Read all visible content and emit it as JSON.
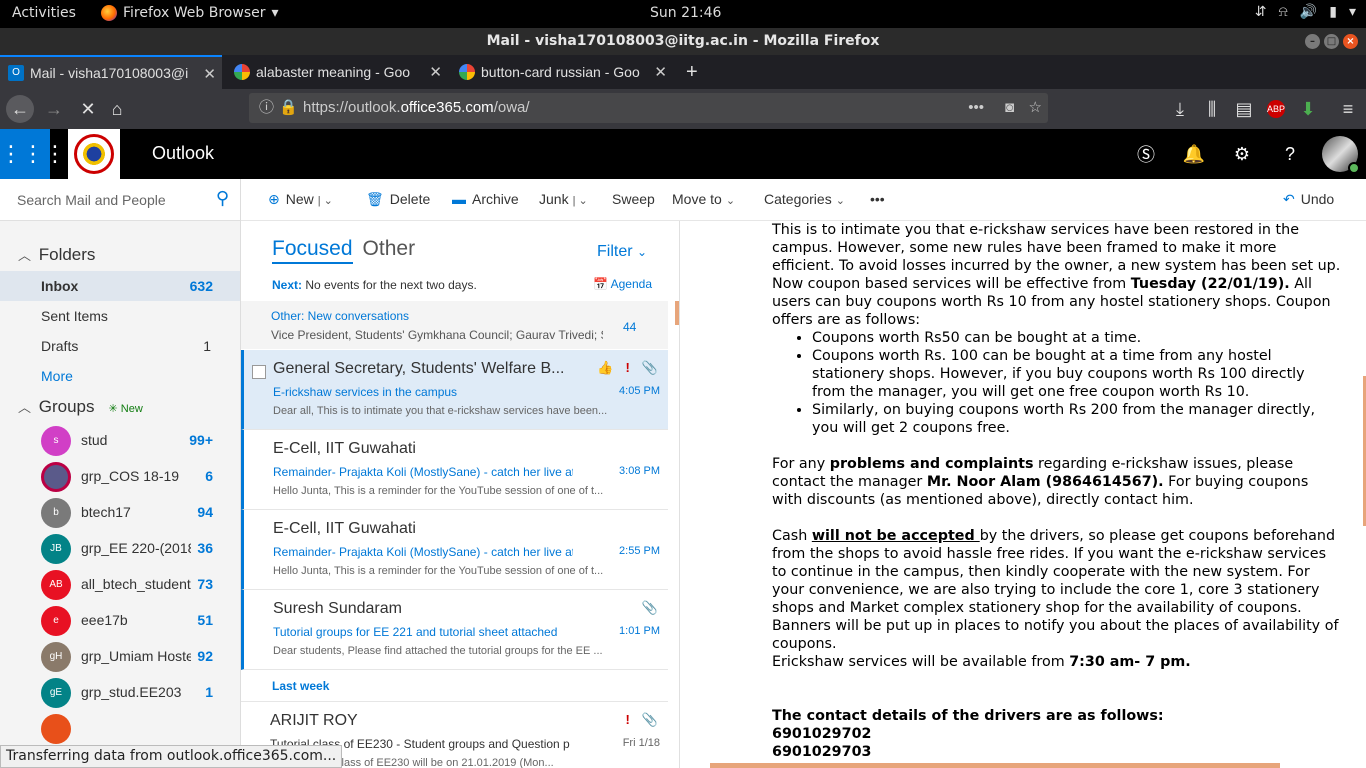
{
  "system": {
    "activities": "Activities",
    "app": "Firefox Web Browser",
    "clock": "Sun 21:46"
  },
  "window": {
    "title": "Mail - visha170108003@iitg.ac.in - Mozilla Firefox"
  },
  "tabs": [
    {
      "label": "Mail - visha170108003@i"
    },
    {
      "label": "alabaster meaning - Goo"
    },
    {
      "label": "button-card russian - Goo"
    }
  ],
  "url": {
    "prefix": "https://outlook.",
    "domain": "office365.com",
    "path": "/owa/"
  },
  "owa": {
    "brand": "Outlook"
  },
  "search": {
    "placeholder": "Search Mail and People"
  },
  "folders": {
    "heading": "Folders",
    "items": [
      {
        "label": "Inbox",
        "count": "632"
      },
      {
        "label": "Sent Items",
        "count": ""
      },
      {
        "label": "Drafts",
        "count": "1"
      }
    ],
    "more": "More"
  },
  "groups": {
    "heading": "Groups",
    "new_label": "New",
    "items": [
      {
        "initials": "s",
        "label": "stud",
        "count": "99+",
        "color": "#d13fc6"
      },
      {
        "initials": "",
        "label": "grp_COS 18-19",
        "count": "6",
        "color": "#5a5a8a"
      },
      {
        "initials": "b",
        "label": "btech17",
        "count": "94",
        "color": "#7a7a7a"
      },
      {
        "initials": "JB",
        "label": "grp_EE 220-(2018",
        "count": "36",
        "color": "#038387"
      },
      {
        "initials": "AB",
        "label": "all_btech_students",
        "count": "73",
        "color": "#e81123"
      },
      {
        "initials": "e",
        "label": "eee17b",
        "count": "51",
        "color": "#e81123"
      },
      {
        "initials": "gH",
        "label": "grp_Umiam Hoste",
        "count": "92",
        "color": "#8a7a6a"
      },
      {
        "initials": "gE",
        "label": "grp_stud.EE203",
        "count": "1",
        "color": "#038387"
      }
    ]
  },
  "toolbar": {
    "new": "New",
    "delete": "Delete",
    "archive": "Archive",
    "junk": "Junk",
    "sweep": "Sweep",
    "move": "Move to",
    "categories": "Categories",
    "more": "•••",
    "undo": "Undo"
  },
  "list": {
    "focused": "Focused",
    "other": "Other",
    "filter": "Filter",
    "next_label": "Next:",
    "next_text": "No events for the next two days.",
    "agenda": "Agenda",
    "other_conv": {
      "title": "Other: New conversations",
      "senders": "Vice President, Students' Gymkhana Council; Gaurav Trivedi; S...",
      "count": "44"
    },
    "messages": [
      {
        "from": "General Secretary, Students' Welfare B...",
        "subject": "E-rickshaw services in the campus",
        "preview": "Dear all, This is to intimate you that e-rickshaw services have been...",
        "time": "4:05 PM"
      },
      {
        "from": "E-Cell, IIT Guwahati",
        "subject": "Remainder- Prajakta Koli (MostlySane) - catch her live at 5:",
        "preview": "Hello Junta, This is a reminder for the YouTube session of one of t...",
        "time": "3:08 PM"
      },
      {
        "from": "E-Cell, IIT Guwahati",
        "subject": "Remainder- Prajakta Koli (MostlySane) - catch her live at 5:",
        "preview": "Hello Junta, This is a reminder for the YouTube session of one of t...",
        "time": "2:55 PM"
      },
      {
        "from": "Suresh Sundaram",
        "subject": "Tutorial groups for EE 221 and tutorial sheet attached",
        "preview": "Dear students, Please find attached the tutorial groups for the EE ...",
        "time": "1:01 PM"
      }
    ],
    "last_week": "Last week",
    "old_message": {
      "from": "ARIJIT ROY",
      "subject": "Tutorial class of EE230 - Student groups and Question pape",
      "preview": "e first tutorial class of EE230 will be on 21.01.2019 (Mon...",
      "time": "Fri 1/18"
    }
  },
  "email": {
    "p1": "This is to intimate you that e-rickshaw services have been restored in the campus. However, some new rules have been framed to make it more efficient. To avoid losses incurred by the owner, a new system has been set up. Now coupon based services will be effective from ",
    "p1_bold": "Tuesday (22/01/19).",
    "p1_tail": " All users can buy coupons worth Rs 10 from any hostel stationery shops. Coupon offers are as follows:",
    "bullets": [
      "Coupons worth Rs50 can be bought at a time.",
      "Coupons worth Rs. 100 can be bought at a time from any hostel stationery shops. However, if you buy coupons worth Rs 100 directly from the manager, you will get one free coupon worth Rs 10.",
      "Similarly, on buying coupons worth Rs 200 from the manager directly, you will get 2 coupons free."
    ],
    "p2_a": "For any ",
    "p2_b": "problems and complaints",
    "p2_c": " regarding e-rickshaw issues, please contact the manager ",
    "p2_d": "Mr. Noor Alam (9864614567).",
    "p2_e": " For buying coupons with discounts (as mentioned above), directly contact him.",
    "p3_a": "Cash ",
    "p3_b": "will not be accepted ",
    "p3_c": "by the drivers, so please get coupons beforehand from the shops to avoid hassle free rides. If you want the e-rickshaw services to continue in the campus, then kindly cooperate with the new system. For your convenience, we are also trying to include the core 1, core 3 stationery shops and Market complex stationery shop for the availability of coupons. Banners will be put up in places to notify you about the places of availability of coupons.",
    "p4_a": "Erickshaw services will be available from ",
    "p4_b": "7:30 am- 7 pm.",
    "contacts_heading": "The contact details of the drivers are as follows:",
    "phone1": "6901029702",
    "phone2": "6901029703"
  },
  "statusbar": "Transferring data from outlook.office365.com..."
}
